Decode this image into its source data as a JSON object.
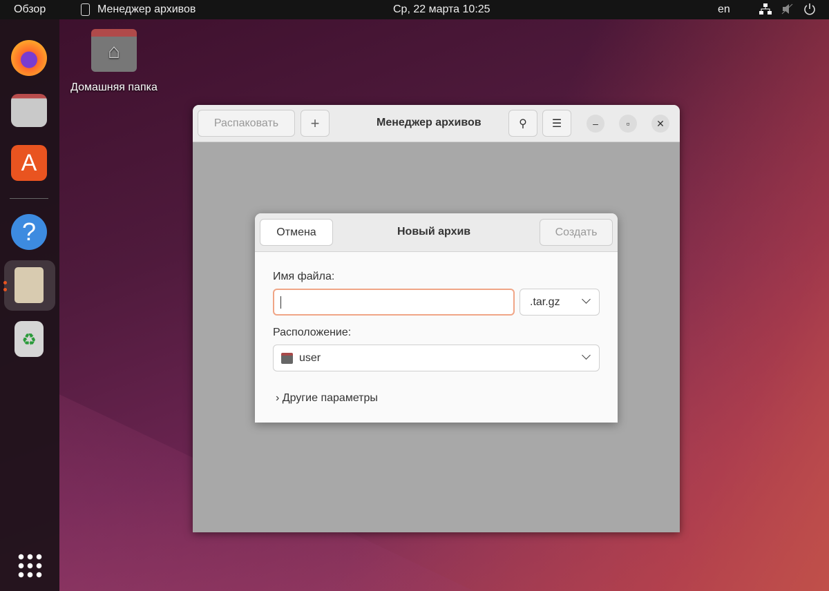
{
  "topbar": {
    "overview": "Обзор",
    "app_name": "Менеджер архивов",
    "datetime": "Ср, 22 марта  10:25",
    "language": "en"
  },
  "desktop": {
    "home_folder_label": "Домашняя папка"
  },
  "dock": {
    "items": [
      "firefox",
      "files",
      "app-center",
      "help",
      "archive-manager",
      "trash",
      "show-apps"
    ],
    "active": "archive-manager"
  },
  "window": {
    "title": "Менеджер архивов",
    "extract_button": "Распаковать",
    "add_button": "+"
  },
  "dialog": {
    "title": "Новый архив",
    "cancel_button": "Отмена",
    "create_button": "Создать",
    "filename_label": "Имя файла:",
    "filename_value": "",
    "extension": ".tar.gz",
    "location_label": "Расположение:",
    "location_value": "user",
    "more_options": "Другие параметры"
  },
  "colors": {
    "accent": "#e95420",
    "focus_border": "#f0a586"
  }
}
